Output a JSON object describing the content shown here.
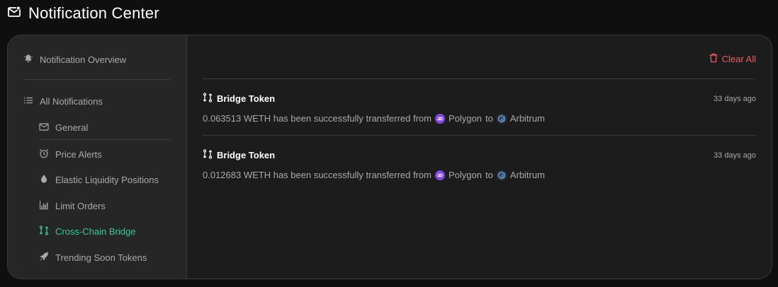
{
  "header": {
    "title": "Notification Center",
    "icon": "mail-icon"
  },
  "sidebar": {
    "overview": {
      "label": "Notification Overview",
      "icon": "bell-icon"
    },
    "all": {
      "label": "All Notifications",
      "icon": "list-icon"
    },
    "items": [
      {
        "label": "General",
        "icon": "mail-icon"
      },
      {
        "label": "Price Alerts",
        "icon": "alarm-clock-icon"
      },
      {
        "label": "Elastic Liquidity Positions",
        "icon": "droplet-icon"
      },
      {
        "label": "Limit Orders",
        "icon": "bar-chart-icon"
      },
      {
        "label": "Cross-Chain Bridge",
        "icon": "bridge-arrows-icon",
        "active": true
      },
      {
        "label": "Trending Soon Tokens",
        "icon": "rocket-icon"
      }
    ]
  },
  "content": {
    "clear_all_label": "Clear All",
    "notifications": [
      {
        "title": "Bridge Token",
        "time": "33 days ago",
        "message": "0.063513 WETH has been successfully transferred from",
        "from_chain": "Polygon",
        "to_word": "to",
        "to_chain": "Arbitrum"
      },
      {
        "title": "Bridge Token",
        "time": "33 days ago",
        "message": "0.012683 WETH has been successfully transferred from",
        "from_chain": "Polygon",
        "to_word": "to",
        "to_chain": "Arbitrum"
      }
    ]
  },
  "colors": {
    "accent": "#31cb9e",
    "danger": "#f45a64",
    "polygon": "#8247e5",
    "arbitrum": "#2d374b"
  }
}
